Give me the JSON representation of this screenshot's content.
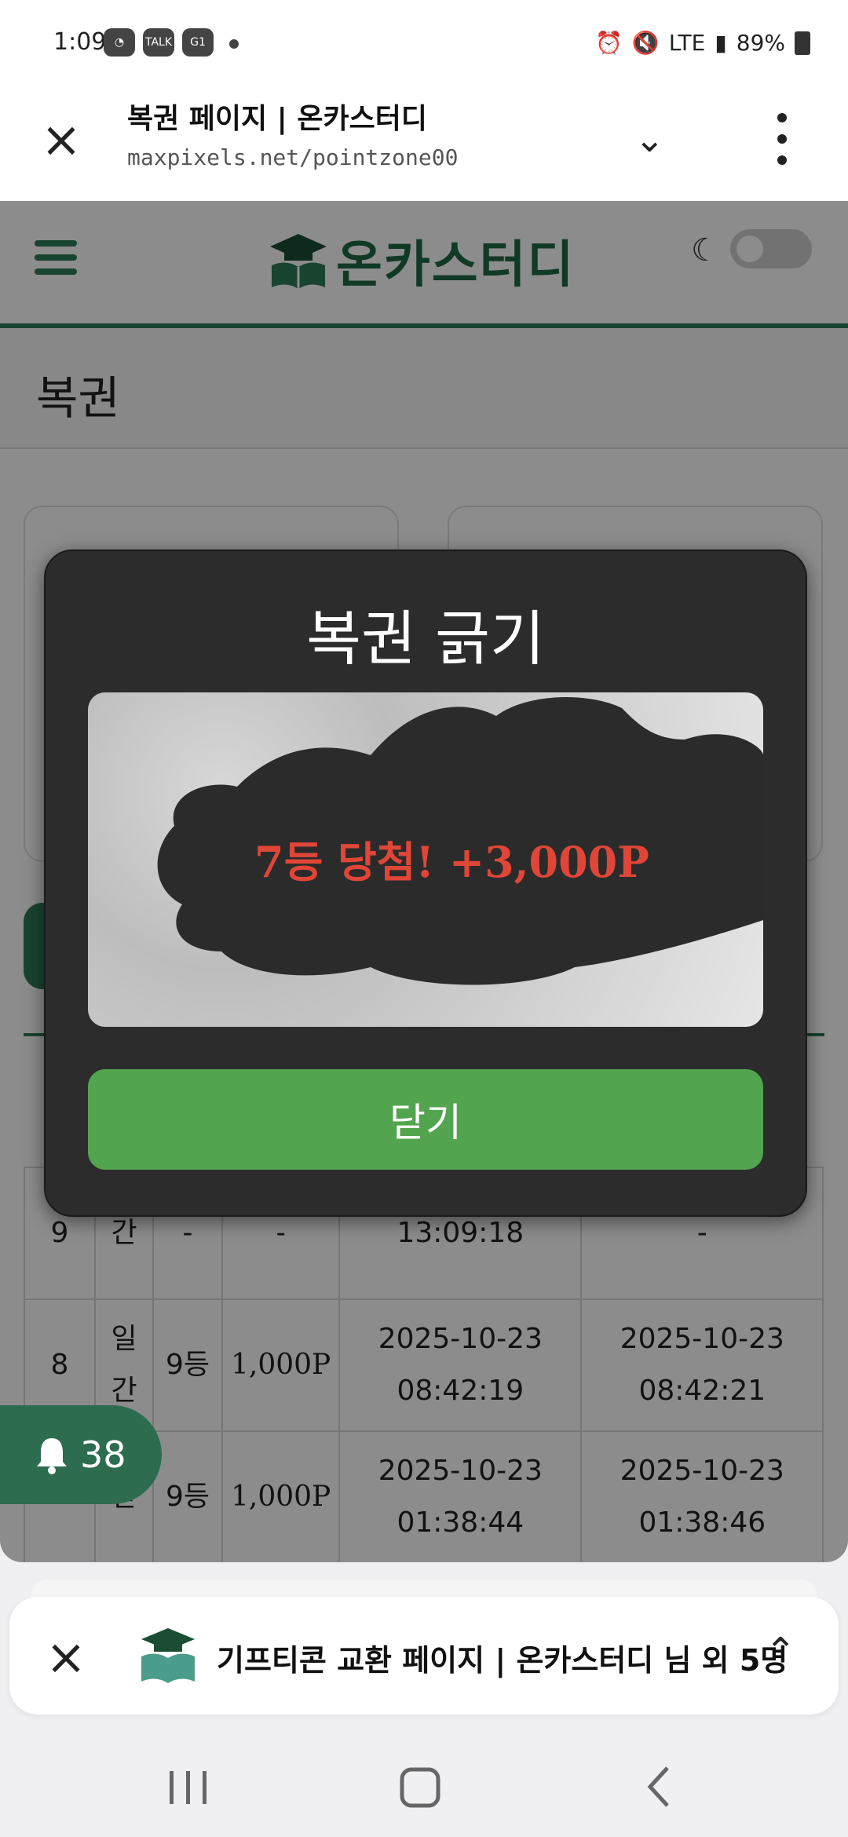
{
  "status_bar": {
    "time": "1:09",
    "app_icons": [
      "TALK",
      "G1"
    ],
    "signal_text": "LTE",
    "battery": "89%"
  },
  "browser": {
    "title": "복권 페이지 | 온카스터디",
    "url": "maxpixels.net/pointzone00"
  },
  "site": {
    "logo_text": "온카스터디",
    "page_title": "복권"
  },
  "history": {
    "rows": [
      {
        "no": "9",
        "type": "간",
        "rank": "-",
        "point": "-",
        "d1": "13:09:18",
        "d2": "-"
      },
      {
        "no": "8",
        "type": "일\n간",
        "rank": "9등",
        "point": "1,000P",
        "d1": "2025-10-23\n08:42:19",
        "d2": "2025-10-23\n08:42:21"
      },
      {
        "no": "",
        "type": "간",
        "rank": "9등",
        "point": "1,000P",
        "d1": "2025-10-23\n01:38:44",
        "d2": "2025-10-23\n01:38:46"
      }
    ]
  },
  "notification": {
    "count": "38"
  },
  "modal": {
    "title": "복권 긁기",
    "prize_text": "7등 당첨! +3,000P",
    "close_label": "닫기"
  },
  "tabs": {
    "current_label": "기프티콘 교환 페이지 | 온카스터디 님 외 5명"
  },
  "colors": {
    "brand_green": "#2e7d57",
    "button_green": "#52a54e",
    "prize_red": "#e04638",
    "modal_bg": "#2c2c2c"
  }
}
